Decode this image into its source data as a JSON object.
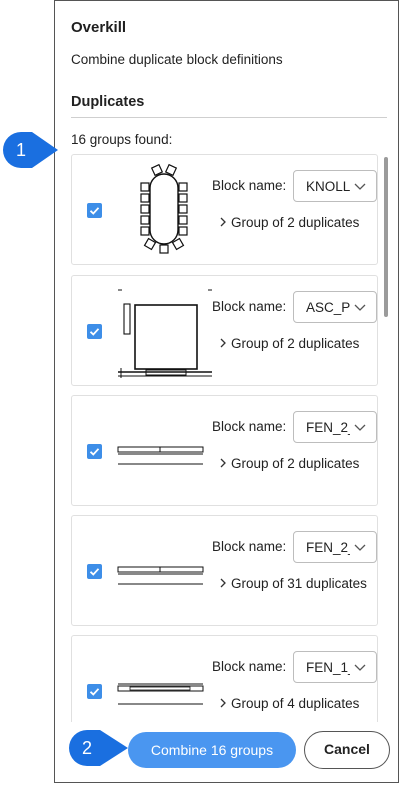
{
  "dialog": {
    "title": "Overkill",
    "subtitle": "Combine duplicate block definitions",
    "section_title": "Duplicates",
    "groups_found": "16 groups found:"
  },
  "groups": [
    {
      "block_name_label": "Block name:",
      "block_name": "KNOLL",
      "group_text": "Group of 2 duplicates",
      "checked": true,
      "thumbnail": "conference-table-icon"
    },
    {
      "block_name_label": "Block name:",
      "block_name": "ASC_P",
      "group_text": "Group of 2 duplicates",
      "checked": true,
      "thumbnail": "cabinet-icon"
    },
    {
      "block_name_label": "Block name:",
      "block_name": "FEN_2_",
      "group_text": "Group of 2 duplicates",
      "checked": true,
      "thumbnail": "window-icon"
    },
    {
      "block_name_label": "Block name:",
      "block_name": "FEN_2_",
      "group_text": "Group of 31 duplicates",
      "checked": true,
      "thumbnail": "window-icon"
    },
    {
      "block_name_label": "Block name:",
      "block_name": "FEN_1_",
      "group_text": "Group of 4 duplicates",
      "checked": true,
      "thumbnail": "window-icon"
    }
  ],
  "buttons": {
    "combine": "Combine 16 groups",
    "cancel": "Cancel"
  },
  "callouts": [
    "1",
    "2"
  ],
  "colors": {
    "accent": "#3d8ee8",
    "callout": "#1a6fe0"
  }
}
